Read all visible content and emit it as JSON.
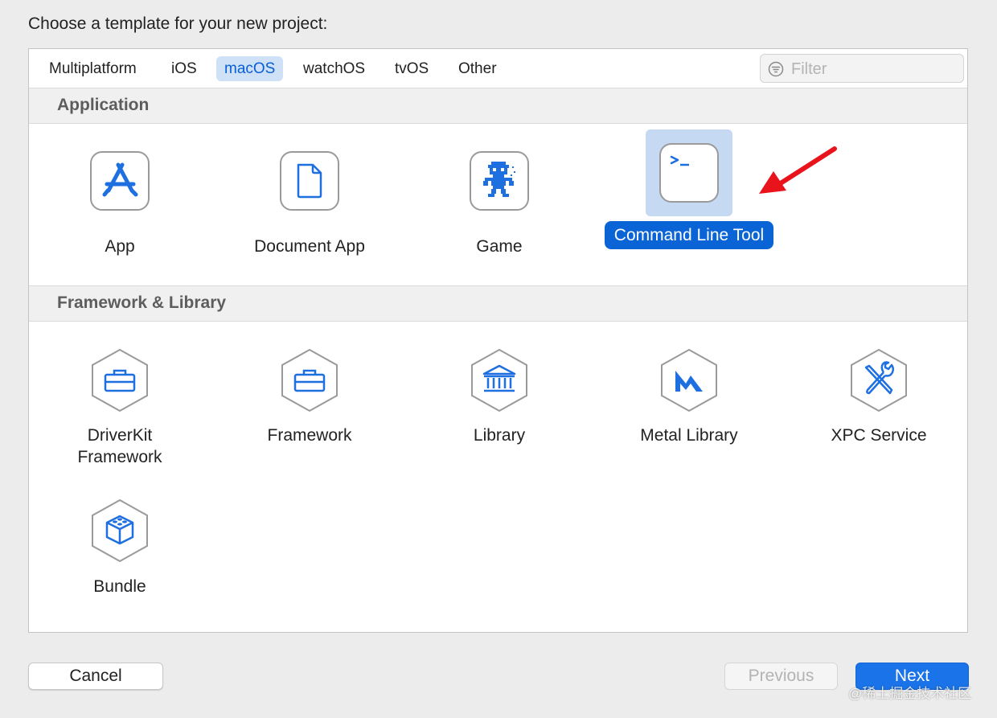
{
  "dialog": {
    "title": "Choose a template for your new project:"
  },
  "tabs": [
    {
      "label": "Multiplatform",
      "active": false
    },
    {
      "label": "iOS",
      "active": false
    },
    {
      "label": "macOS",
      "active": true
    },
    {
      "label": "watchOS",
      "active": false
    },
    {
      "label": "tvOS",
      "active": false
    },
    {
      "label": "Other",
      "active": false
    }
  ],
  "filter": {
    "placeholder": "Filter",
    "value": "",
    "icon": "filter-icon"
  },
  "sections": [
    {
      "title": "Application",
      "items": [
        {
          "label": "App",
          "icon": "app-store-icon",
          "selected": false
        },
        {
          "label": "Document App",
          "icon": "document-icon",
          "selected": false
        },
        {
          "label": "Game",
          "icon": "game-icon",
          "selected": false
        },
        {
          "label": "Command Line Tool",
          "icon": "terminal-icon",
          "selected": true
        }
      ]
    },
    {
      "title": "Framework & Library",
      "items": [
        {
          "label": "DriverKit Framework",
          "icon": "toolbox-icon",
          "selected": false
        },
        {
          "label": "Framework",
          "icon": "toolbox-icon",
          "selected": false
        },
        {
          "label": "Library",
          "icon": "library-building-icon",
          "selected": false
        },
        {
          "label": "Metal Library",
          "icon": "metal-icon",
          "selected": false
        },
        {
          "label": "XPC Service",
          "icon": "tools-icon",
          "selected": false
        },
        {
          "label": "Bundle",
          "icon": "cube-icon",
          "selected": false
        }
      ]
    }
  ],
  "buttons": {
    "cancel": "Cancel",
    "previous": "Previous",
    "next": "Next"
  },
  "watermark": "@稀土掘金技术社区",
  "colors": {
    "accent": "#0a64d6",
    "icon_blue": "#1e6fe0",
    "annotation_arrow": "#e8131b"
  }
}
